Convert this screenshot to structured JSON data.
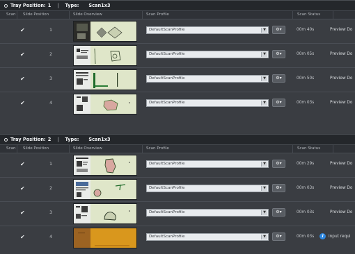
{
  "columns": {
    "scan": "Scan",
    "slide_position": "Slide Position",
    "slide_overview": "Slide Overview",
    "scan_profile": "Scan Profile",
    "scan_status": "Scan Status"
  },
  "trays": [
    {
      "position_label": "Tray Position:",
      "position_value": "1",
      "separator": "|",
      "type_label": "Type:",
      "type_value": "Scan1x3",
      "rows": [
        {
          "checked": "✔",
          "slide_position": "1",
          "profile": "DefaultScanProfile",
          "time": "00m 40s",
          "status": "Preview Do"
        },
        {
          "checked": "✔",
          "slide_position": "2",
          "profile": "DefaultScanProfile",
          "time": "00m 05s",
          "status": "Preview Do"
        },
        {
          "checked": "✔",
          "slide_position": "3",
          "profile": "DefaultScanProfile",
          "time": "00m 50s",
          "status": "Preview Do"
        },
        {
          "checked": "✔",
          "slide_position": "4",
          "profile": "DefaultScanProfile",
          "time": "00m 03s",
          "status": "Preview Do"
        }
      ]
    },
    {
      "position_label": "Tray Position:",
      "position_value": "2",
      "separator": "|",
      "type_label": "Type:",
      "type_value": "Scan1x3",
      "rows": [
        {
          "checked": "✔",
          "slide_position": "1",
          "profile": "DefaultScanProfile",
          "time": "00m 29s",
          "status": "Preview Do"
        },
        {
          "checked": "✔",
          "slide_position": "2",
          "profile": "DefaultScanProfile",
          "time": "00m 03s",
          "status": "Preview Do"
        },
        {
          "checked": "✔",
          "slide_position": "3",
          "profile": "DefaultScanProfile",
          "time": "00m 03s",
          "status": "Preview Do"
        },
        {
          "checked": "✔",
          "slide_position": "4",
          "profile": "DefaultScanProfile",
          "time": "00m 03s",
          "status": "input requi",
          "info_icon": "info-icon"
        }
      ]
    }
  ],
  "icons": {
    "collapse": "collapse-circle-icon",
    "dropdown": "chevron-down-icon",
    "settings": "gear-icon"
  },
  "colors": {
    "info_blue": "#2f88e0",
    "slide_background": "#dfe6c9",
    "tissue_pink": "#d8a7a0",
    "orange_slide": "#d9971d"
  }
}
